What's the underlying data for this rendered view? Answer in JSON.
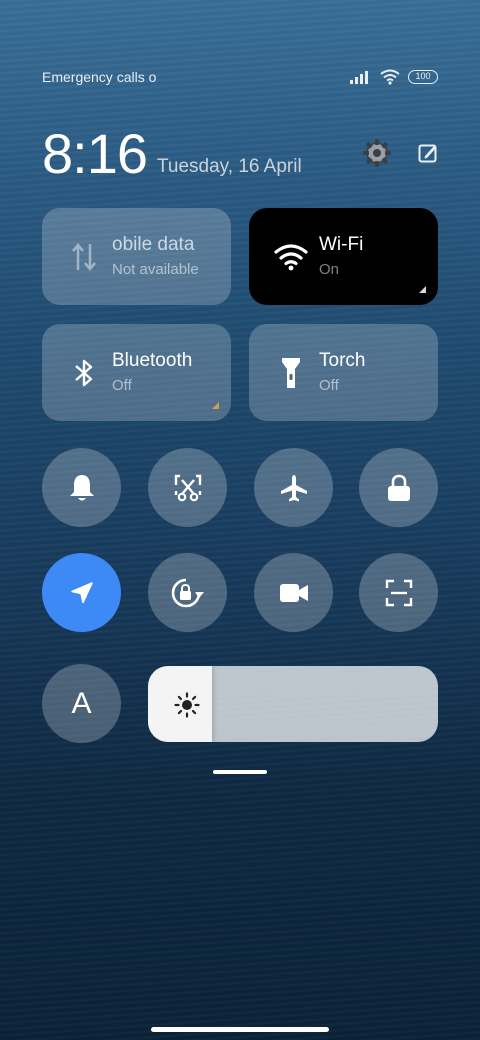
{
  "status_bar": {
    "carrier_text": "Emergency calls o",
    "battery_level": "100",
    "icons": [
      "signal-icon",
      "wifi-icon",
      "battery-icon"
    ]
  },
  "header": {
    "time": "8:16",
    "date": "Tuesday, 16 April",
    "actions": [
      "settings-icon",
      "edit-icon"
    ]
  },
  "tiles": [
    {
      "title": "obile data",
      "subtitle": "Not available",
      "icon": "mobile-data-icon",
      "state": "disabled"
    },
    {
      "title": "Wi-Fi",
      "subtitle": "On",
      "icon": "wifi-icon",
      "state": "on"
    },
    {
      "title": "Bluetooth",
      "subtitle": "Off",
      "icon": "bluetooth-icon",
      "state": "off"
    },
    {
      "title": "Torch",
      "subtitle": "Off",
      "icon": "torch-icon",
      "state": "off"
    }
  ],
  "toggles": [
    {
      "icon": "bell-icon",
      "state": "off"
    },
    {
      "icon": "screenshot-icon",
      "state": "off"
    },
    {
      "icon": "airplane-icon",
      "state": "off"
    },
    {
      "icon": "lock-icon",
      "state": "off"
    },
    {
      "icon": "location-icon",
      "state": "on"
    },
    {
      "icon": "rotation-lock-icon",
      "state": "off"
    },
    {
      "icon": "video-camera-icon",
      "state": "off"
    },
    {
      "icon": "scan-icon",
      "state": "off"
    }
  ],
  "font_toggle": {
    "label": "A"
  },
  "brightness": {
    "level": 0.22,
    "icon": "sun-icon"
  },
  "colors": {
    "accent": "#3d8af7",
    "active_tile": "#000000"
  }
}
